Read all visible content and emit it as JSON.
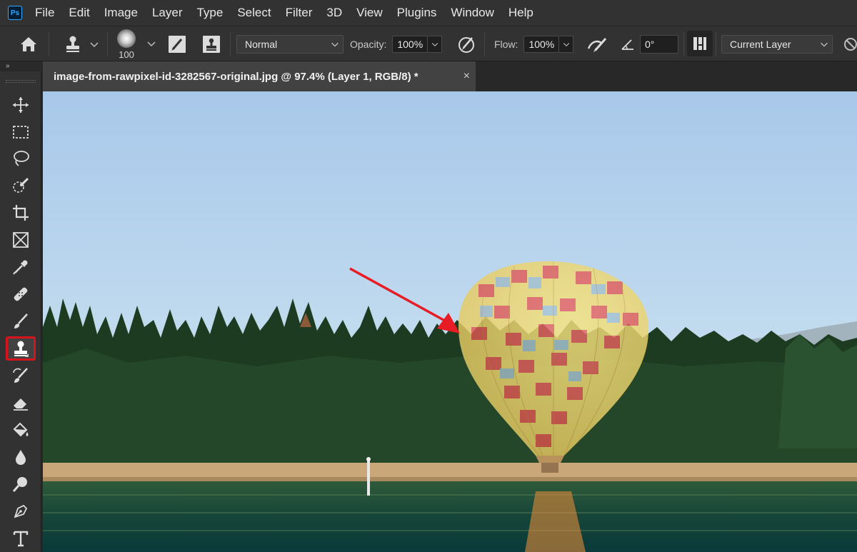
{
  "app": {
    "logo_text": "Ps"
  },
  "menu": [
    "File",
    "Edit",
    "Image",
    "Layer",
    "Type",
    "Select",
    "Filter",
    "3D",
    "View",
    "Plugins",
    "Window",
    "Help"
  ],
  "options": {
    "brush_size": "100",
    "blend_mode": "Normal",
    "opacity_label": "Opacity:",
    "opacity_value": "100%",
    "flow_label": "Flow:",
    "flow_value": "100%",
    "angle_value": "0°",
    "sample_value": "Current Layer"
  },
  "panel": {
    "collapse_glyph": "»"
  },
  "document": {
    "tab_title": "image-from-rawpixel-id-3282567-original.jpg @ 97.4% (Layer 1, RGB/8) *",
    "close_glyph": "×"
  },
  "tools": [
    {
      "name": "move-tool",
      "icon": "move-icon"
    },
    {
      "name": "marquee-tool",
      "icon": "marquee-icon"
    },
    {
      "name": "lasso-tool",
      "icon": "lasso-icon"
    },
    {
      "name": "quick-selection-tool",
      "icon": "quick-select-icon"
    },
    {
      "name": "crop-tool",
      "icon": "crop-icon"
    },
    {
      "name": "frame-tool",
      "icon": "frame-icon"
    },
    {
      "name": "eyedropper-tool",
      "icon": "eyedropper-icon"
    },
    {
      "name": "healing-brush-tool",
      "icon": "bandage-icon"
    },
    {
      "name": "brush-tool",
      "icon": "brush-icon"
    },
    {
      "name": "clone-stamp-tool",
      "icon": "stamp-icon",
      "active": true
    },
    {
      "name": "history-brush-tool",
      "icon": "history-brush-icon"
    },
    {
      "name": "eraser-tool",
      "icon": "eraser-icon"
    },
    {
      "name": "paint-bucket-tool",
      "icon": "bucket-icon"
    },
    {
      "name": "blur-tool",
      "icon": "drop-icon"
    },
    {
      "name": "dodge-tool",
      "icon": "dodge-icon"
    },
    {
      "name": "pen-tool",
      "icon": "pen-icon"
    },
    {
      "name": "type-tool",
      "icon": "type-icon"
    }
  ],
  "colors": {
    "highlight": "#d7131e",
    "arrow": "#e81c24",
    "sky_top": "#a9c9ea",
    "sky_bottom": "#cfe1ee",
    "forest": "#1f3d22",
    "sand": "#c9a778",
    "water": "#0f3b36"
  }
}
